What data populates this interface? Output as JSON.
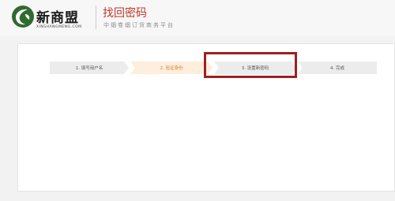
{
  "header": {
    "logo_name": "新商盟",
    "logo_sub": "XINSHANGMENG.COM",
    "title": "找回密码",
    "subtitle": "中烟卷烟订货商务平台"
  },
  "steps": [
    {
      "label": "1. 填写用户名",
      "state": "done"
    },
    {
      "label": "2. 验证身份",
      "state": "active"
    },
    {
      "label": "3. 设置新密码",
      "state": "pending"
    },
    {
      "label": "4. 完成",
      "state": "pending"
    }
  ],
  "colors": {
    "brand_red": "#c0392b",
    "active_step_text": "#e07a2e",
    "active_step_bg": "#fdeedd",
    "highlight_border": "#a31e1e",
    "logo_green": "#2e6b2f"
  }
}
